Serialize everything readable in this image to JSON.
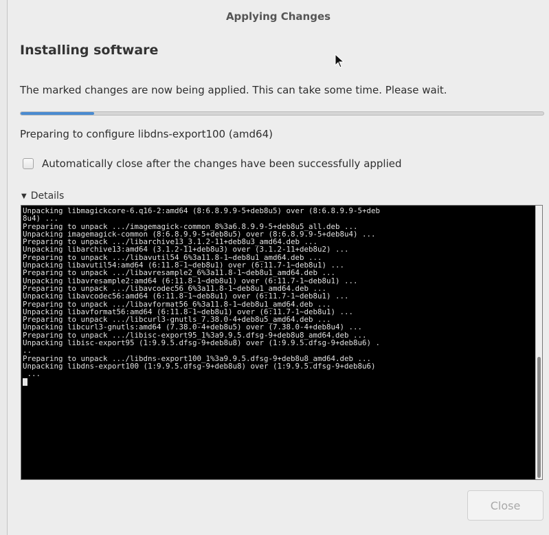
{
  "window": {
    "title": "Applying Changes"
  },
  "heading": "Installing software",
  "message": "The marked changes are now being applied. This can take some time. Please wait.",
  "progress": {
    "fraction": 0.14,
    "color": "#4a8bd1"
  },
  "status_text": "Preparing to configure libdns-export100 (amd64)",
  "autoclose": {
    "label": "Automatically close after the changes have been successfully applied",
    "checked": false
  },
  "details": {
    "label": "Details",
    "expanded": true,
    "icon": "triangle-down-icon"
  },
  "terminal": {
    "lines": [
      "Unpacking libmagickcore-6.q16-2:amd64 (8:6.8.9.9-5+deb8u5) over (8:6.8.9.9-5+deb",
      "8u4) ...",
      "Preparing to unpack .../imagemagick-common_8%3a6.8.9.9-5+deb8u5_all.deb ...",
      "Unpacking imagemagick-common (8:6.8.9.9-5+deb8u5) over (8:6.8.9.9-5+deb8u4) ...",
      "Preparing to unpack .../libarchive13_3.1.2-11+deb8u3_amd64.deb ...",
      "Unpacking libarchive13:amd64 (3.1.2-11+deb8u3) over (3.1.2-11+deb8u2) ...",
      "Preparing to unpack .../libavutil54_6%3a11.8-1~deb8u1_amd64.deb ...",
      "Unpacking libavutil54:amd64 (6:11.8-1~deb8u1) over (6:11.7-1~deb8u1) ...",
      "Preparing to unpack .../libavresample2_6%3a11.8-1~deb8u1_amd64.deb ...",
      "Unpacking libavresample2:amd64 (6:11.8-1~deb8u1) over (6:11.7-1~deb8u1) ...",
      "Preparing to unpack .../libavcodec56_6%3a11.8-1~deb8u1_amd64.deb ...",
      "Unpacking libavcodec56:amd64 (6:11.8-1~deb8u1) over (6:11.7-1~deb8u1) ...",
      "Preparing to unpack .../libavformat56_6%3a11.8-1~deb8u1_amd64.deb ...",
      "Unpacking libavformat56:amd64 (6:11.8-1~deb8u1) over (6:11.7-1~deb8u1) ...",
      "Preparing to unpack .../libcurl3-gnutls_7.38.0-4+deb8u5_amd64.deb ...",
      "Unpacking libcurl3-gnutls:amd64 (7.38.0-4+deb8u5) over (7.38.0-4+deb8u4) ...",
      "Preparing to unpack .../libisc-export95_1%3a9.9.5.dfsg-9+deb8u8_amd64.deb ...",
      "Unpacking libisc-export95 (1:9.9.5.dfsg-9+deb8u8) over (1:9.9.5.dfsg-9+deb8u6) .",
      "..",
      "Preparing to unpack .../libdns-export100_1%3a9.9.5.dfsg-9+deb8u8_amd64.deb ...",
      "Unpacking libdns-export100 (1:9.9.5.dfsg-9+deb8u8) over (1:9.9.5.dfsg-9+deb8u6)",
      " ..."
    ]
  },
  "close_button": {
    "label": "Close",
    "enabled": false
  }
}
